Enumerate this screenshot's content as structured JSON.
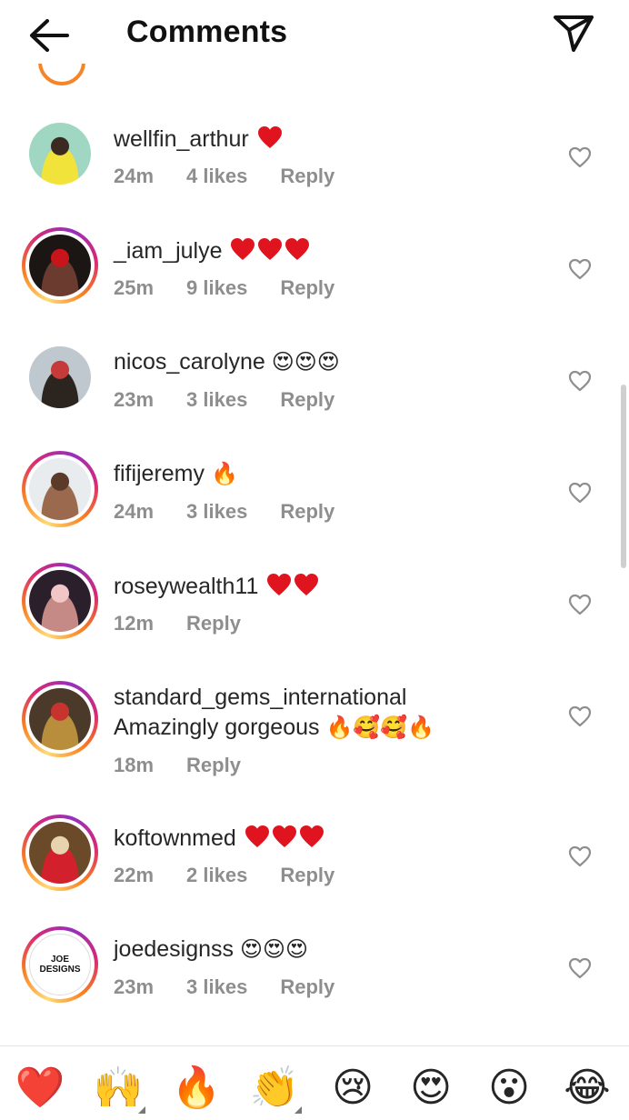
{
  "header": {
    "title": "Comments",
    "back_icon": "arrow-left-icon",
    "send_icon": "paper-plane-icon"
  },
  "comments": [
    {
      "username": "wellfin_arthur",
      "text": "",
      "emoji": "",
      "hearts": 1,
      "time": "24m",
      "likes": "4 likes",
      "reply": "Reply",
      "avatar_ring": false,
      "avatar_palette": [
        "#9fd7c3",
        "#f2e33a",
        "#3a2a22"
      ]
    },
    {
      "username": "_iam_julye",
      "text": "",
      "emoji": "",
      "hearts": 3,
      "time": "25m",
      "likes": "9 likes",
      "reply": "Reply",
      "avatar_ring": true,
      "avatar_palette": [
        "#1b1613",
        "#6a3b2e",
        "#c8141b"
      ]
    },
    {
      "username": "nicos_carolyne",
      "text": "",
      "emoji": "😍😍😍",
      "hearts": 0,
      "time": "23m",
      "likes": "3 likes",
      "reply": "Reply",
      "avatar_ring": false,
      "avatar_palette": [
        "#bfc7cf",
        "#2b241f",
        "#c63a3a"
      ]
    },
    {
      "username": "fifijeremy",
      "text": "",
      "emoji": "🔥",
      "hearts": 0,
      "time": "24m",
      "likes": "3 likes",
      "reply": "Reply",
      "avatar_ring": true,
      "avatar_palette": [
        "#e8ecef",
        "#9b6a4e",
        "#5b3a2a"
      ]
    },
    {
      "username": "roseywealth11",
      "text": "",
      "emoji": "",
      "hearts": 2,
      "time": "12m",
      "likes": "",
      "reply": "Reply",
      "avatar_ring": true,
      "avatar_palette": [
        "#2b1f2c",
        "#c58a86",
        "#f2c6c6"
      ]
    },
    {
      "username": "standard_gems_international",
      "text": "Amazingly gorgeous",
      "emoji": "🔥🥰🥰🔥",
      "hearts": 0,
      "time": "18m",
      "likes": "",
      "reply": "Reply",
      "avatar_ring": true,
      "avatar_palette": [
        "#4b3a2a",
        "#b88e3c",
        "#c9332e"
      ]
    },
    {
      "username": "koftownmed",
      "text": "",
      "emoji": "",
      "hearts": 3,
      "time": "22m",
      "likes": "2 likes",
      "reply": "Reply",
      "avatar_ring": true,
      "avatar_palette": [
        "#6b4a2a",
        "#d2202c",
        "#e7d3b0"
      ]
    },
    {
      "username": "joedesignss",
      "text": "",
      "emoji": "😍😍😍",
      "hearts": 0,
      "time": "23m",
      "likes": "3 likes",
      "reply": "Reply",
      "avatar_ring": true,
      "avatar_palette": [
        "#ffffff",
        "#111111",
        "#111111"
      ],
      "avatar_text": [
        "JOE",
        "DESIGNS"
      ]
    }
  ],
  "emoji_bar": [
    "❤️",
    "🙌",
    "🔥",
    "👏",
    "😢",
    "😍",
    "😮",
    "😂"
  ],
  "colors": {
    "text": "#262626",
    "meta": "#8e8e8e",
    "heart_red": "#e0141e",
    "divider": "#e3e3e3"
  }
}
